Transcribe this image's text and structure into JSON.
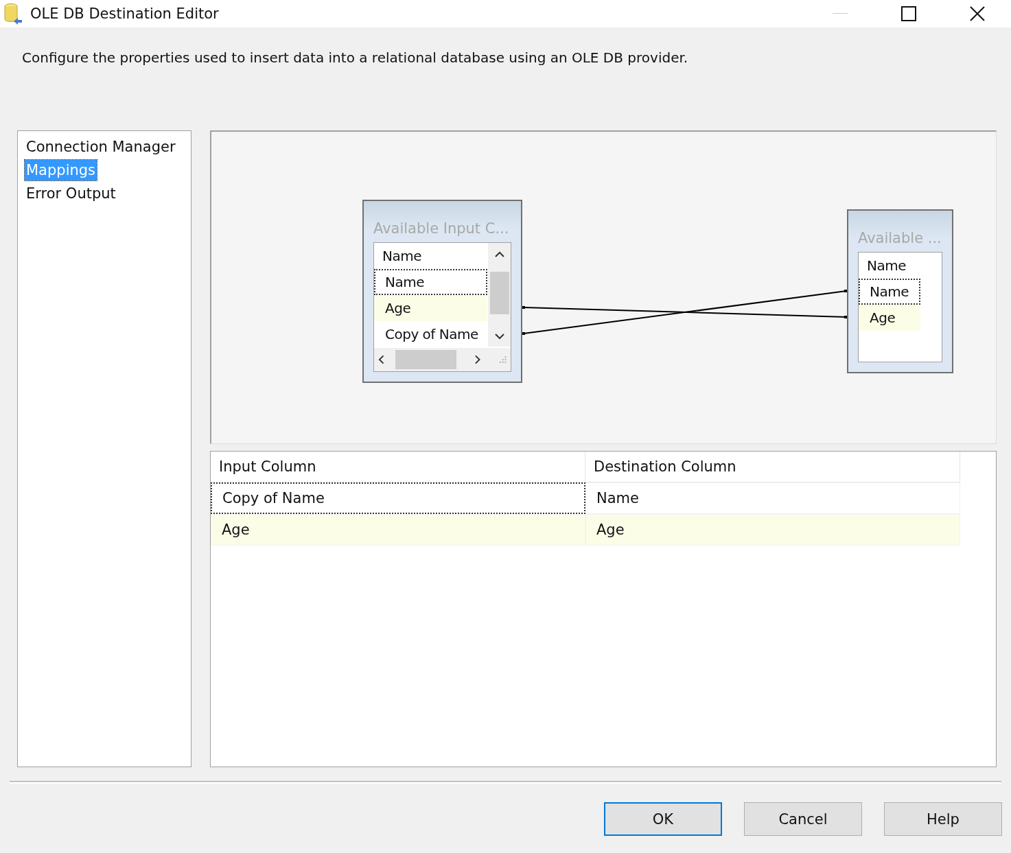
{
  "window": {
    "title": "OLE DB Destination Editor"
  },
  "description": "Configure the properties used to insert data into a relational database using an OLE DB provider.",
  "sidebar": {
    "items": [
      {
        "label": "Connection Manager",
        "selected": false
      },
      {
        "label": "Mappings",
        "selected": true
      },
      {
        "label": "Error Output",
        "selected": false
      }
    ]
  },
  "diagram": {
    "input_table": {
      "title": "Available Input C...",
      "header": "Name",
      "rows": [
        {
          "label": "Name",
          "focused": true,
          "highlighted": false
        },
        {
          "label": "Age",
          "focused": false,
          "highlighted": true
        },
        {
          "label": "Copy of Name",
          "focused": false,
          "highlighted": false
        }
      ]
    },
    "destination_table": {
      "title": "Available ...",
      "header": "Name",
      "rows": [
        {
          "label": "Name",
          "focused": true,
          "highlighted": false
        },
        {
          "label": "Age",
          "focused": false,
          "highlighted": true
        }
      ]
    }
  },
  "grid": {
    "columns": [
      "Input Column",
      "Destination Column"
    ],
    "rows": [
      {
        "cells": [
          "Copy of Name",
          "Name"
        ],
        "focused": true,
        "highlighted": false
      },
      {
        "cells": [
          "Age",
          "Age"
        ],
        "focused": false,
        "highlighted": true
      }
    ]
  },
  "buttons": [
    {
      "label": "OK",
      "default": true
    },
    {
      "label": "Cancel",
      "default": false
    },
    {
      "label": "Help",
      "default": false
    }
  ]
}
